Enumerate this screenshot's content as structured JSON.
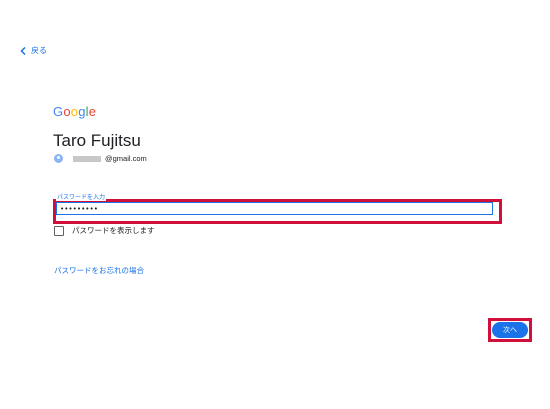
{
  "nav": {
    "back_label": "戻る"
  },
  "brand": {
    "logo_letters": [
      {
        "char": "G",
        "color": "#4285F4"
      },
      {
        "char": "o",
        "color": "#EA4335"
      },
      {
        "char": "o",
        "color": "#FBBC05"
      },
      {
        "char": "g",
        "color": "#4285F4"
      },
      {
        "char": "l",
        "color": "#34A853"
      },
      {
        "char": "e",
        "color": "#EA4335"
      }
    ]
  },
  "account": {
    "display_name": "Taro Fujitsu",
    "email_suffix": "@gmail.com"
  },
  "password_field": {
    "label": "パスワードを入力",
    "value": "•••••••••"
  },
  "show_password": {
    "label": "パスワードを表示します",
    "checked": false
  },
  "links": {
    "forgot_password": "パスワードをお忘れの場合"
  },
  "actions": {
    "next_label": "次へ"
  },
  "colors": {
    "accent": "#1a73e8",
    "highlight": "#d0103a"
  },
  "icons": {
    "back": "chevron-left-icon",
    "avatar": "account-circle-icon"
  }
}
